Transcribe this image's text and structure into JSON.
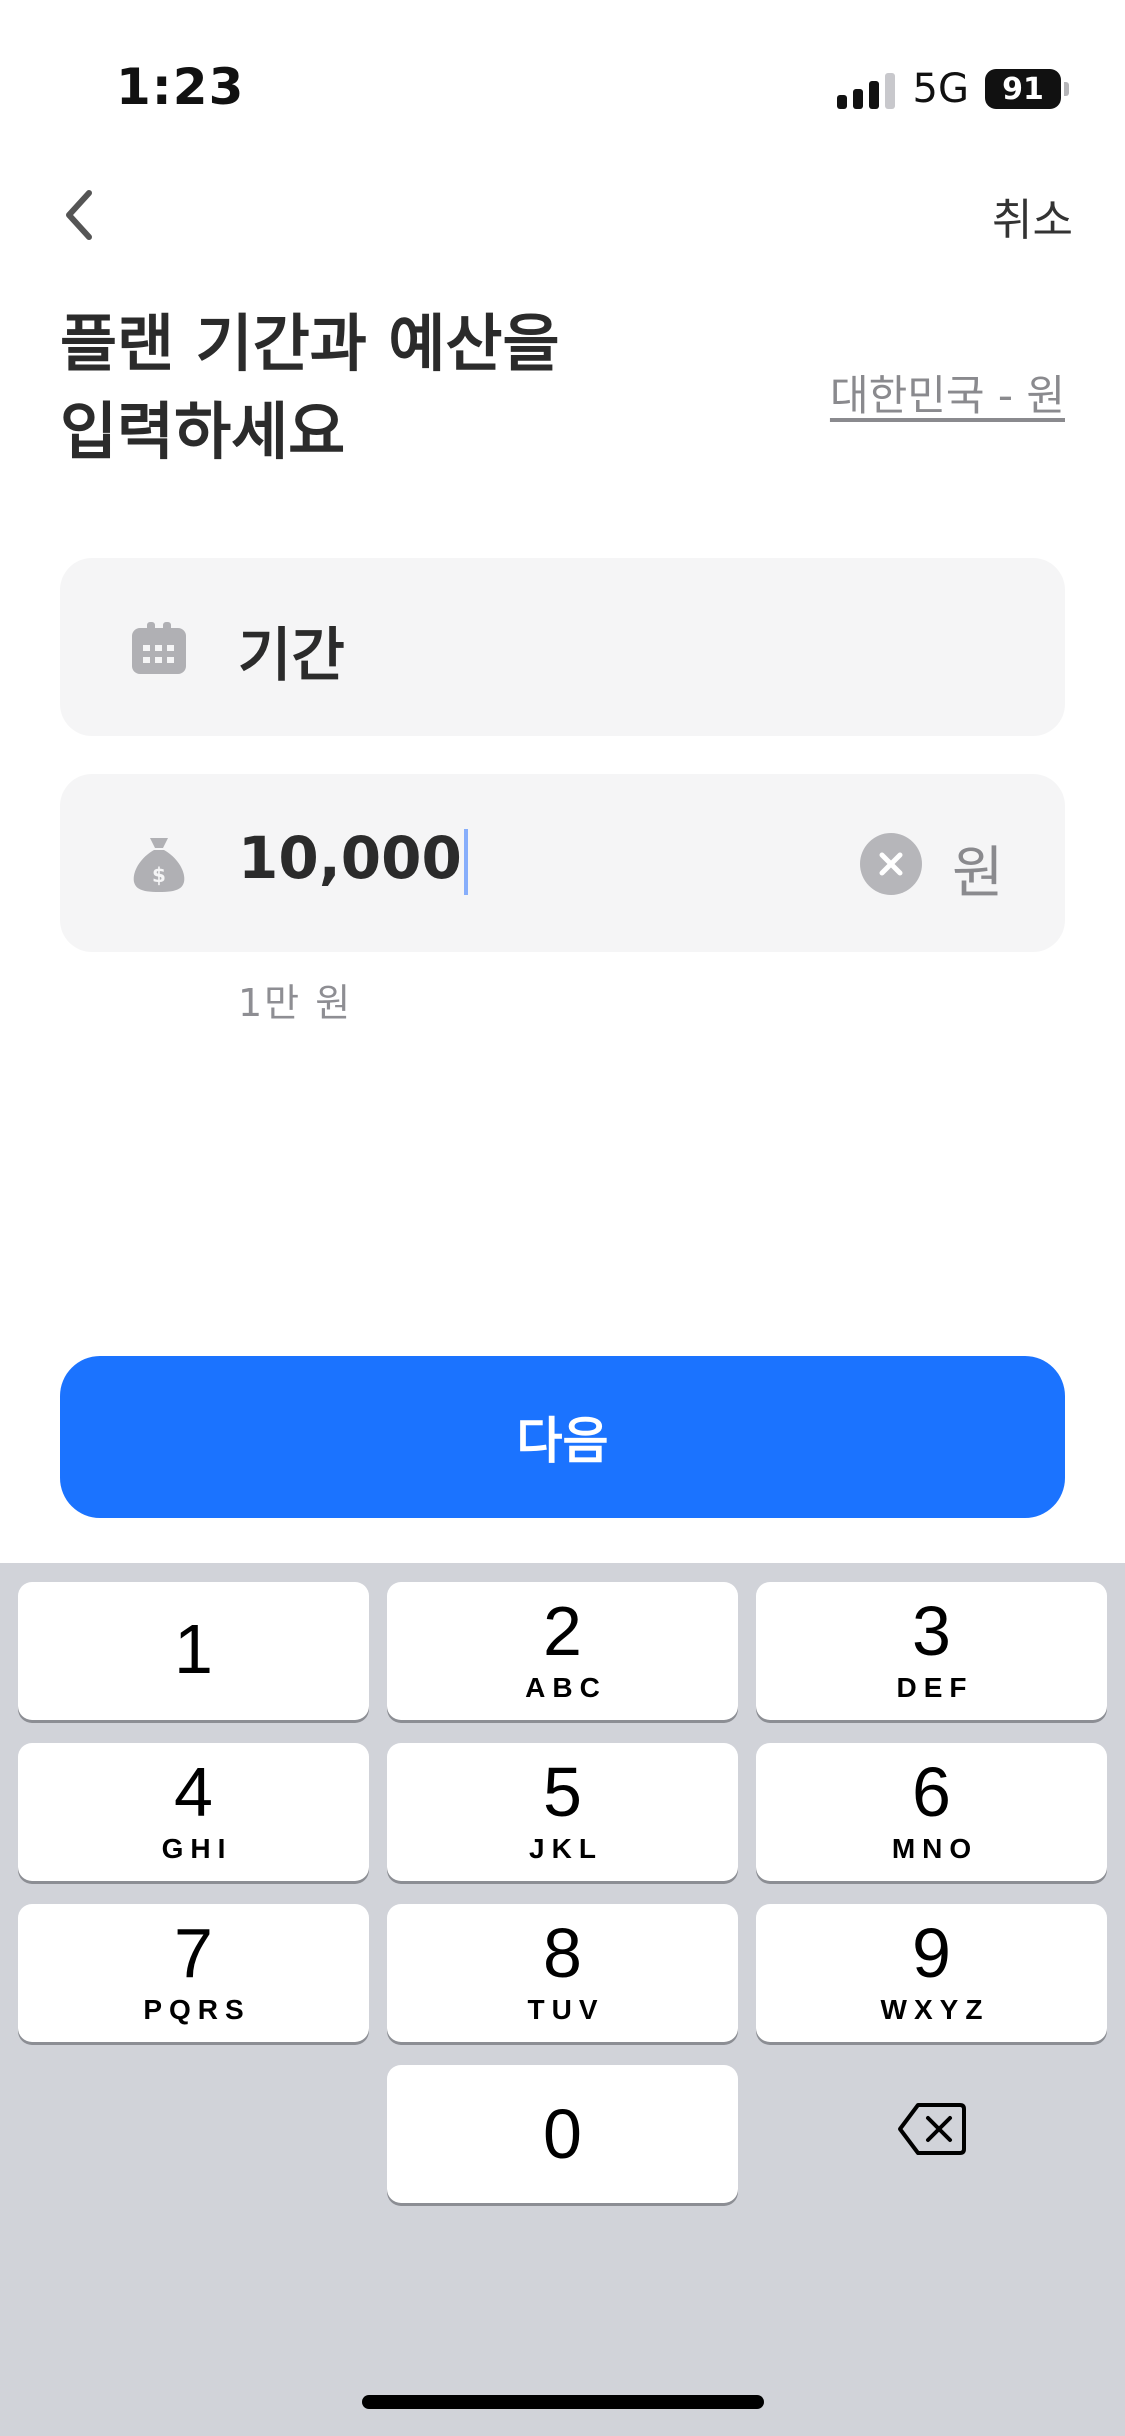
{
  "status_bar": {
    "time": "1:23",
    "network": "5G",
    "battery": "91"
  },
  "nav": {
    "back_icon": "chevron-left-icon",
    "cancel_label": "취소"
  },
  "title": "플랜 기간과 예산을\n입력하세요",
  "region_link": "대한민국 - 원",
  "period_field": {
    "icon": "calendar-icon",
    "placeholder": "기간"
  },
  "budget_field": {
    "icon": "money-bag-icon",
    "value": "10,000",
    "unit": "원",
    "helper": "1만 원"
  },
  "next_button": {
    "label": "다음"
  },
  "keyboard": {
    "keys": [
      {
        "num": "1",
        "letters": ""
      },
      {
        "num": "2",
        "letters": "ABC"
      },
      {
        "num": "3",
        "letters": "DEF"
      },
      {
        "num": "4",
        "letters": "GHI"
      },
      {
        "num": "5",
        "letters": "JKL"
      },
      {
        "num": "6",
        "letters": "MNO"
      },
      {
        "num": "7",
        "letters": "PQRS"
      },
      {
        "num": "8",
        "letters": "TUV"
      },
      {
        "num": "9",
        "letters": "WXYZ"
      },
      {
        "num": "0",
        "letters": ""
      }
    ],
    "delete_icon": "backspace-icon"
  },
  "colors": {
    "accent": "#1b73ff",
    "field_bg": "#f5f5f6",
    "keyboard_bg": "#d1d3d9"
  }
}
